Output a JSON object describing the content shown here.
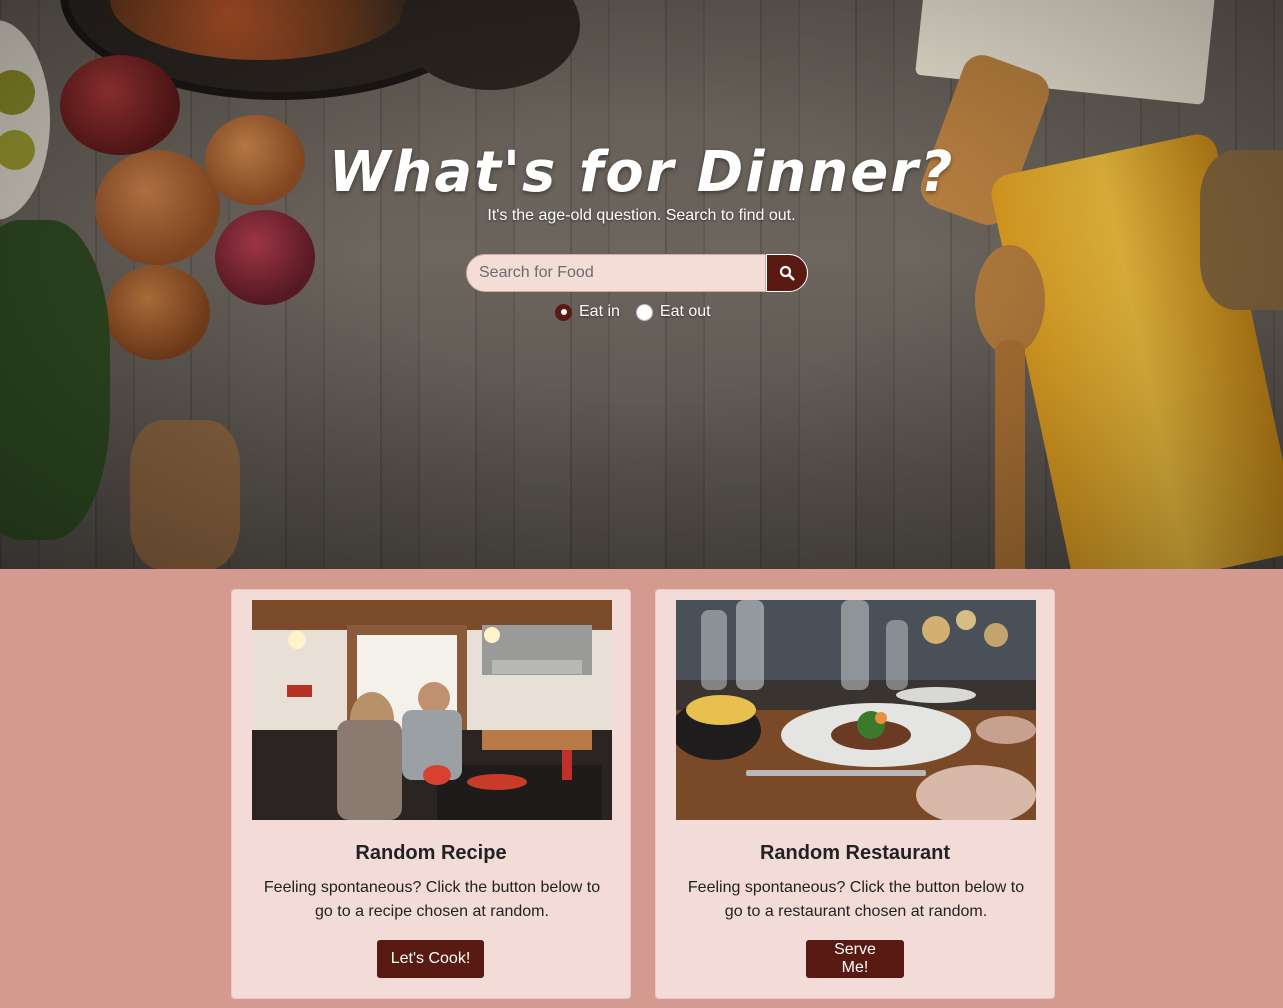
{
  "hero": {
    "title": "What's for Dinner?",
    "subtitle": "It's the age-old question. Search to find out.",
    "search": {
      "placeholder": "Search for Food",
      "value": "",
      "button_icon": "search-icon"
    },
    "options": [
      {
        "label": "Eat in",
        "checked": true
      },
      {
        "label": "Eat out",
        "checked": false
      }
    ]
  },
  "cards": [
    {
      "title": "Random Recipe",
      "text": "Feeling spontaneous? Click the button below to go to a recipe chosen at random.",
      "button": "Let's Cook!"
    },
    {
      "title": "Random Restaurant",
      "text": "Feeling spontaneous? Click the button below to go to a restaurant chosen at random.",
      "button": "Serve Me!"
    }
  ],
  "colors": {
    "accent": "#5a1a14",
    "page_bg": "#d49a90",
    "card_bg": "#f3dbd7",
    "input_bg": "#f4dcd7"
  }
}
